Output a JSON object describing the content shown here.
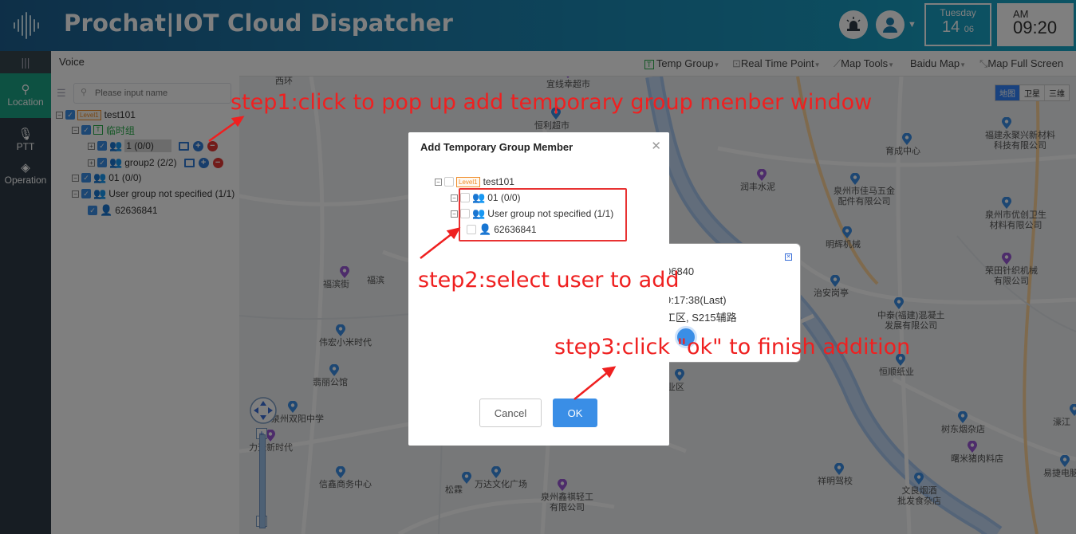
{
  "header": {
    "title": "Prochat|IOT Cloud Dispatcher",
    "weekday": "Tuesday",
    "day": "14",
    "month": "06",
    "ampm": "AM",
    "time": "09:20",
    "colors": {
      "accent": "#1aa385",
      "brand": "#1d6fa0"
    }
  },
  "sidenav": {
    "menu_icon": "menu-icon",
    "items": [
      {
        "label": "Location",
        "icon": "location-pin-icon",
        "active": true
      },
      {
        "label": "PTT",
        "icon": "microphone-icon",
        "active": false
      },
      {
        "label": "Operation",
        "icon": "layers-icon",
        "active": false
      }
    ]
  },
  "panel": {
    "title": "Voice",
    "search_placeholder": "Please input name",
    "tree": {
      "root_level": "Level1",
      "root_name": "test101",
      "temp_group": "临时组",
      "temp_group_badge": "T",
      "group1": "1 (0/0)",
      "group2": "group2 (2/2)",
      "group3": "01 (0/0)",
      "group4": "User group not specified (1/1)",
      "user": "62636841"
    }
  },
  "toolbar": {
    "temp_group": "Temp Group",
    "realtime_point": "Real Time Point",
    "map_tools": "Map Tools",
    "baidu_map": "Baidu Map",
    "full_screen": "Map Full Screen",
    "map_types": [
      "地图",
      "卫星",
      "三维"
    ]
  },
  "map": {
    "labels": [
      {
        "text": "宜线幸超市"
      },
      {
        "text": "恒利超市"
      },
      {
        "text": "育成中心"
      },
      {
        "text": "福建永聚兴新材料\n科技有限公司"
      },
      {
        "text": "润丰水泥"
      },
      {
        "text": "泉州市佳马五金\n配件有限公司"
      },
      {
        "text": "泉州市优创卫生\n材料有限公司"
      },
      {
        "text": "明辉机械"
      },
      {
        "text": "荣田针织机械\n有限公司"
      },
      {
        "text": "治安岗亭"
      },
      {
        "text": "中泰(福建)混凝土\n发展有限公司"
      },
      {
        "text": "恒顺纸业"
      },
      {
        "text": "福滨街"
      },
      {
        "text": "伟宏小米时代"
      },
      {
        "text": "翡丽公馆"
      },
      {
        "text": "泉州双阳中学"
      },
      {
        "text": "力天新时代"
      },
      {
        "text": "信鑫商务中心"
      },
      {
        "text": "松霖"
      },
      {
        "text": "万达文化广场"
      },
      {
        "text": "泉州鑫祺轻工\n有限公司"
      },
      {
        "text": "祥明驾校"
      },
      {
        "text": "文良烟酒\n批发食杂店"
      },
      {
        "text": "树东烟杂店"
      },
      {
        "text": "曙米猪肉料店"
      },
      {
        "text": "易捷电脑"
      },
      {
        "text": "濠江"
      },
      {
        "text": "工业区"
      },
      {
        "text": "西环"
      },
      {
        "text": "福滨"
      }
    ]
  },
  "info_popup": {
    "id_fragment": "06840",
    "time_fragment": "9:17:38(Last)",
    "addr_fragment": "工区, S215辅路"
  },
  "modal": {
    "title": "Add Temporary Group Member",
    "tree": {
      "root_level": "Level1",
      "root_name": "test101",
      "group1": "01 (0/0)",
      "group2": "User group not specified (1/1)",
      "user": "62636841"
    },
    "cancel_label": "Cancel",
    "ok_label": "OK"
  },
  "annotations": {
    "step1": "step1:click to pop  up add temporary group menber window",
    "step2": "step2:select user to add",
    "step3": "step3:click \"ok\" to finish addition",
    "color": "#ef2020"
  }
}
